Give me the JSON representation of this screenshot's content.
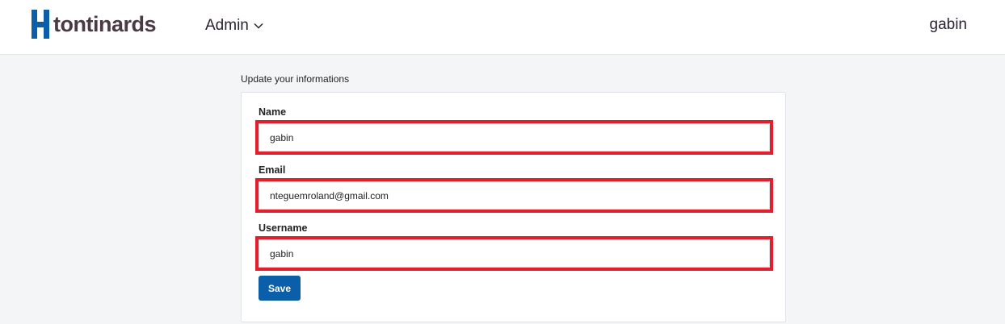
{
  "header": {
    "brand": "tontinards",
    "menu_label": "Admin",
    "user": "gabin",
    "brand_color": "#0a5fa8"
  },
  "page": {
    "section_title": "Update your informations"
  },
  "form": {
    "name_label": "Name",
    "name_value": "gabin",
    "email_label": "Email",
    "email_value": "nteguemroland@gmail.com",
    "username_label": "Username",
    "username_value": "gabin",
    "save_label": "Save",
    "highlight_color": "#e0202c"
  },
  "icons": {
    "logo": "h-logo-icon",
    "menu_chevron": "chevron-down-icon"
  }
}
